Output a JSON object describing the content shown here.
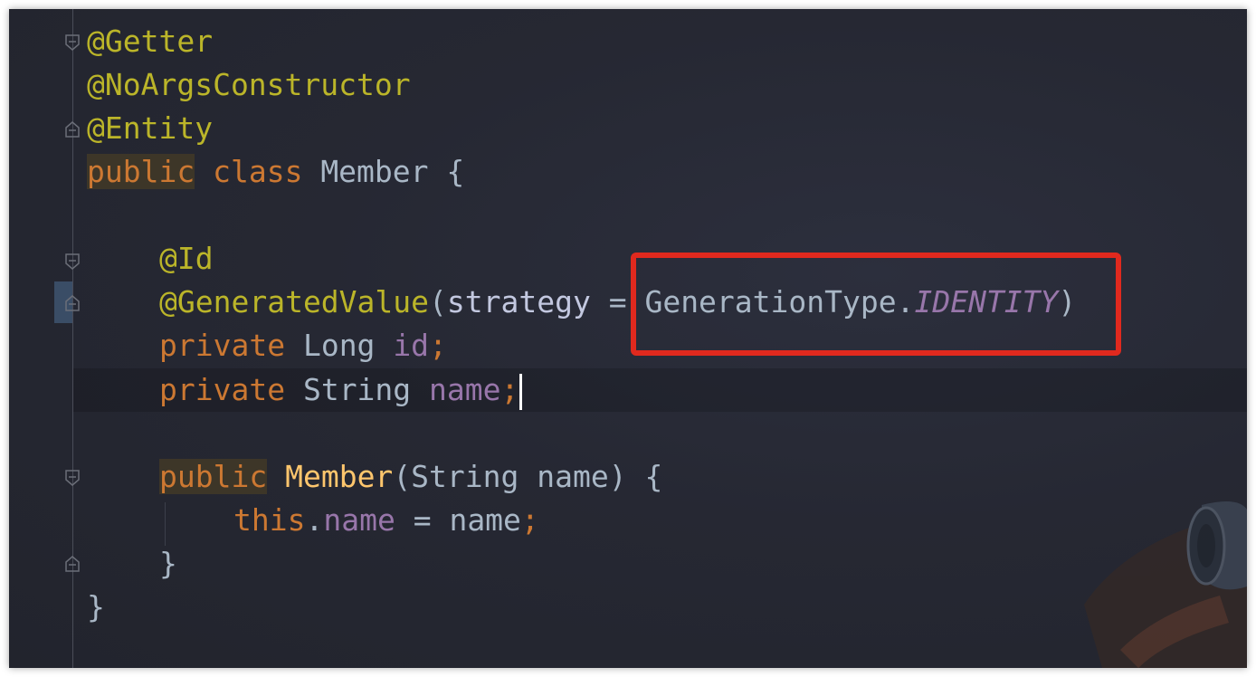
{
  "editor": {
    "theme_colors": {
      "background": "#262833",
      "annotation": "#bbb529",
      "keyword": "#cc7832",
      "field": "#9876aa",
      "method": "#ffc66d",
      "text": "#a9b7c6",
      "highlight_box": "#e0291e"
    },
    "lines": {
      "l1": {
        "annotation": "@Getter"
      },
      "l2": {
        "annotation": "@NoArgsConstructor"
      },
      "l3": {
        "annotation": "@Entity"
      },
      "l4": {
        "kw_public": "public",
        "kw_class": "class",
        "class_name": "Member",
        "brace": "{"
      },
      "l6": {
        "annotation": "@Id"
      },
      "l7": {
        "annotation": "@GeneratedValue",
        "open_paren": "(",
        "param": "strategy",
        "equals": " = ",
        "enum_type": "GenerationType.",
        "enum_constant": "IDENTITY",
        "close_paren": ")"
      },
      "l8": {
        "kw_private": "private",
        "type": "Long",
        "field": "id",
        "semi": ";"
      },
      "l9": {
        "kw_private": "private",
        "type": "String",
        "field": "name",
        "semi": ";"
      },
      "l11": {
        "kw_public": "public",
        "ctor_name": "Member",
        "signature": "(String name)",
        "brace": "{"
      },
      "l12": {
        "kw_this": "this",
        "dot": ".",
        "field": "name",
        "assign": " = name",
        "semi": ";"
      },
      "l13": {
        "brace": "}"
      },
      "l14": {
        "brace": "}"
      }
    }
  }
}
